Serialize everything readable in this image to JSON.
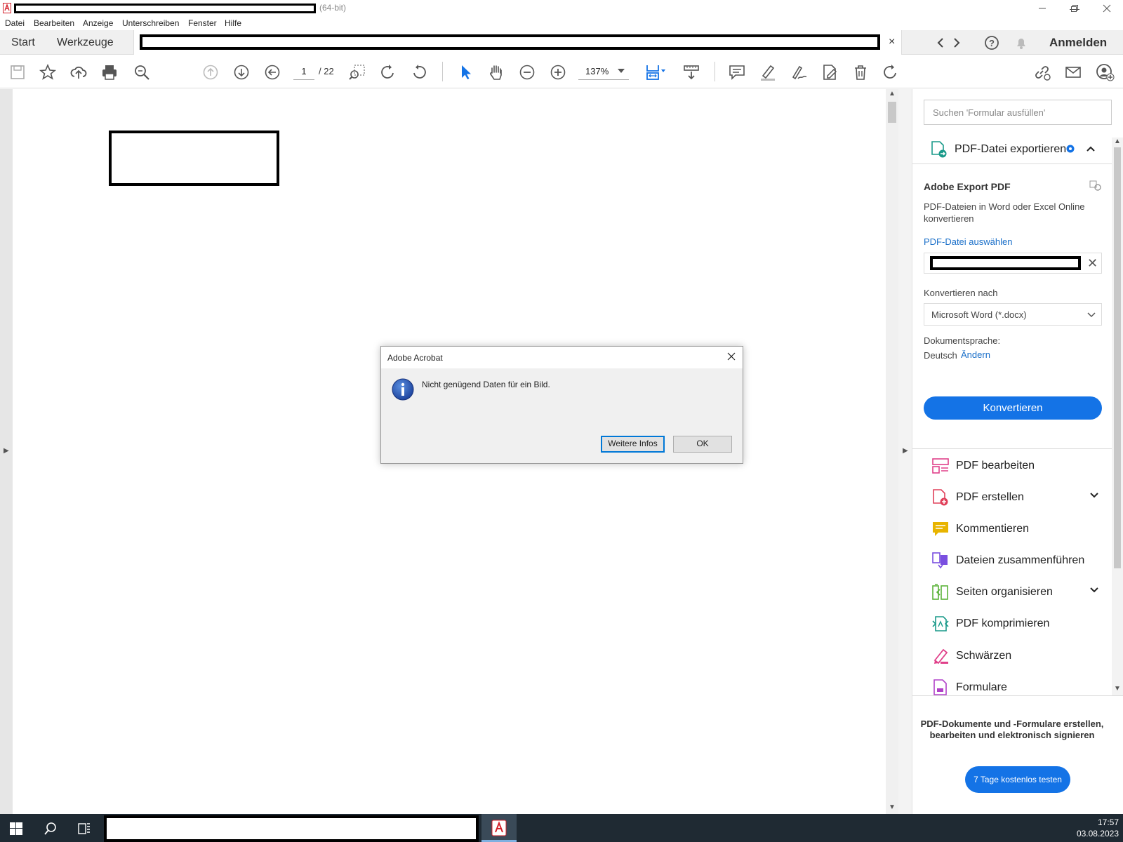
{
  "window": {
    "title_suffix": "(64-bit)",
    "minimize_glyph": "—",
    "restore_glyph": "❐",
    "close_glyph": "✕"
  },
  "menu": [
    "Datei",
    "Bearbeiten",
    "Anzeige",
    "Unterschreiben",
    "Fenster",
    "Hilfe"
  ],
  "tabs": {
    "start": "Start",
    "tools": "Werkzeuge",
    "close_glyph": "×",
    "signin": "Anmelden"
  },
  "toolbar": {
    "page_current": "1",
    "page_total": "/ 22",
    "zoom": "137%"
  },
  "dialog": {
    "title": "Adobe Acrobat",
    "message": "Nicht genügend Daten für ein Bild.",
    "more_info": "Weitere Infos",
    "ok": "OK"
  },
  "right_pane": {
    "search_placeholder": "Suchen 'Formular ausfüllen'",
    "export_title": "PDF-Datei exportieren",
    "export_heading": "Adobe Export PDF",
    "export_desc": "PDF-Dateien in Word oder Excel Online konvertieren",
    "choose_file": "PDF-Datei auswählen",
    "convert_to_label": "Konvertieren nach",
    "convert_to_value": "Microsoft Word (*.docx)",
    "doc_lang_label": "Dokumentsprache:",
    "doc_lang_value": "Deutsch",
    "doc_lang_change": "Ändern",
    "convert_button": "Konvertieren",
    "tools": [
      {
        "label": "PDF bearbeiten",
        "color": "#e0408a",
        "icon": "edit-pdf-icon"
      },
      {
        "label": "PDF erstellen",
        "color": "#e0405a",
        "icon": "create-pdf-icon"
      },
      {
        "label": "Kommentieren",
        "color": "#e8b400",
        "icon": "comment-icon"
      },
      {
        "label": "Dateien zusammenführen",
        "color": "#7a4fe0",
        "icon": "combine-files-icon"
      },
      {
        "label": "Seiten organisieren",
        "color": "#5bb33a",
        "icon": "organize-pages-icon"
      },
      {
        "label": "PDF komprimieren",
        "color": "#1a9a8a",
        "icon": "compress-pdf-icon"
      },
      {
        "label": "Schwärzen",
        "color": "#e0408a",
        "icon": "redact-icon"
      },
      {
        "label": "Formulare",
        "color": "#b040c8",
        "icon": "forms-icon"
      }
    ],
    "promo": "PDF-Dokumente und -Formulare erstellen, bearbeiten und elektronisch signieren",
    "trial_button": "7 Tage kostenlos testen"
  },
  "taskbar": {
    "time": "17:57",
    "date": "03.08.2023"
  },
  "colors": {
    "accent": "#1473e6",
    "link": "#1a6fc9",
    "acrobat_red": "#d4202a",
    "taskbar": "#1f2a33"
  }
}
